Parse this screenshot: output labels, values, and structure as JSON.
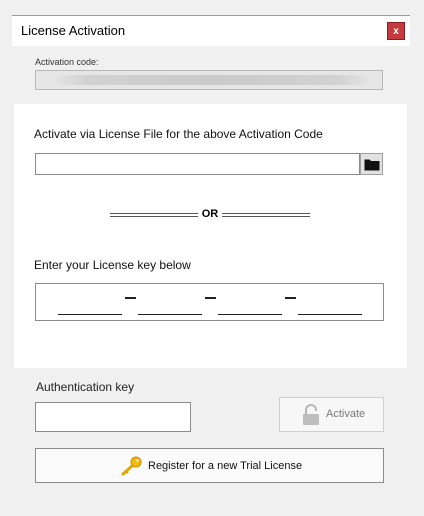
{
  "window": {
    "title": "License Activation",
    "close_label": "x",
    "close_icon": "close-icon"
  },
  "activation_code": {
    "label": "Activation code:",
    "value": ""
  },
  "license_file": {
    "label": "Activate via License File for the above Activation Code",
    "value": "",
    "browse_icon": "folder-icon"
  },
  "separator": {
    "label": "OR"
  },
  "license_key": {
    "label": "Enter your License key below",
    "segments": [
      "",
      "",
      "",
      ""
    ]
  },
  "authentication": {
    "label": "Authentication key",
    "value": ""
  },
  "activate_button": {
    "label": "Activate",
    "icon": "unlocked-padlock-icon",
    "enabled": false
  },
  "register_button": {
    "label": "Register for a new Trial License",
    "icon": "key-icon"
  },
  "colors": {
    "window_background": "#f0f0f0",
    "panel_background": "#ffffff",
    "close_button": "#c43b3f",
    "key_icon": "#f2b90f",
    "disabled_text": "#7a7a7a"
  }
}
